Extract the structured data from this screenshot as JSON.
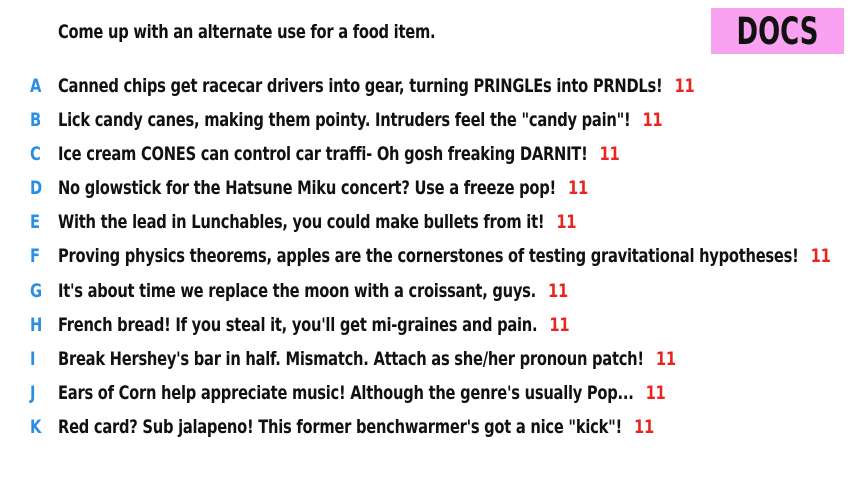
{
  "prompt": "Come up with an alternate use for a food item.",
  "badge": {
    "label": "DOCS",
    "color": "#f9a2f2"
  },
  "colors": {
    "letter": "#2a8fe0",
    "score": "#e8261f",
    "text": "#111111"
  },
  "answers": [
    {
      "letter": "A",
      "text": "Canned chips get racecar drivers into gear, turning PRINGLEs into PRNDLs!",
      "score": "11"
    },
    {
      "letter": "B",
      "text": "Lick candy canes, making them pointy. Intruders feel the \"candy pain\"!",
      "score": "11"
    },
    {
      "letter": "C",
      "text": "Ice cream CONES can control car traffi- Oh gosh freaking DARNIT!",
      "score": "11"
    },
    {
      "letter": "D",
      "text": "No glowstick for the Hatsune Miku concert? Use a freeze pop!",
      "score": "11"
    },
    {
      "letter": "E",
      "text": "With the lead in Lunchables, you could make bullets from it!",
      "score": "11"
    },
    {
      "letter": "F",
      "text": "Proving physics theorems, apples are the cornerstones of testing gravitational hypotheses!",
      "score": "11"
    },
    {
      "letter": "G",
      "text": "It's about time we replace the moon with a croissant, guys.",
      "score": "11"
    },
    {
      "letter": "H",
      "text": "French bread! If you steal it, you'll get mi-graines and pain.",
      "score": "11"
    },
    {
      "letter": "I",
      "text": "Break Hershey's bar in half. Mismatch. Attach as she/her pronoun patch!",
      "score": "11"
    },
    {
      "letter": "J",
      "text": "Ears of Corn help appreciate music! Although the genre's usually Pop...",
      "score": "11"
    },
    {
      "letter": "K",
      "text": "Red card? Sub jalapeno! This former benchwarmer's got a nice \"kick\"!",
      "score": "11"
    }
  ]
}
